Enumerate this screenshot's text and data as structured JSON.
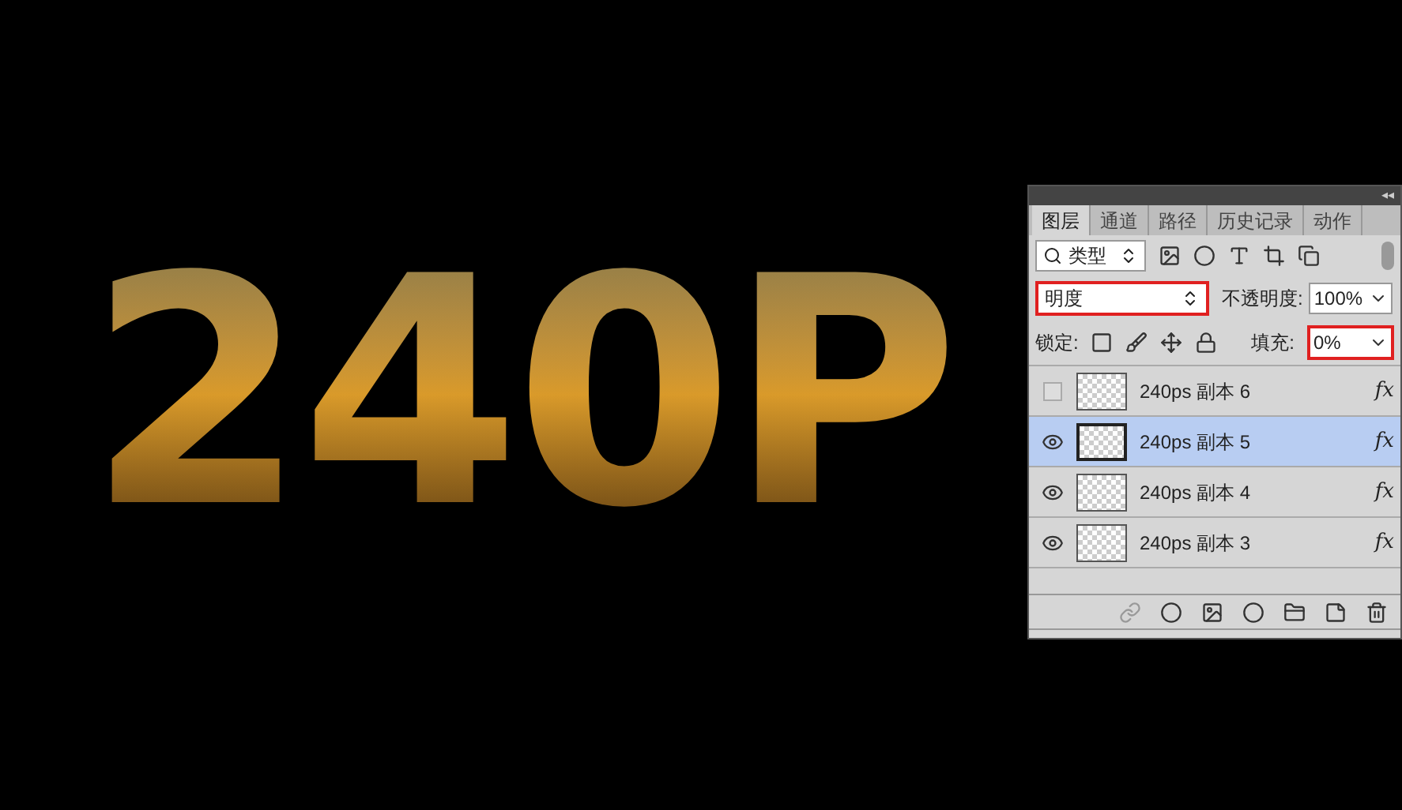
{
  "canvas": {
    "artwork_text": "240P"
  },
  "panel": {
    "collapse": "◂◂",
    "tabs": [
      {
        "label": "图层",
        "selected": true
      },
      {
        "label": "通道",
        "selected": false
      },
      {
        "label": "路径",
        "selected": false
      },
      {
        "label": "历史记录",
        "selected": false
      },
      {
        "label": "动作",
        "selected": false
      }
    ],
    "filter": {
      "value": "类型"
    },
    "blend_mode": {
      "value": "明度",
      "highlighted": true
    },
    "opacity": {
      "label": "不透明度:",
      "value": "100%",
      "highlighted": false
    },
    "lock": {
      "label": "锁定:"
    },
    "fill": {
      "label": "填充:",
      "value": "0%",
      "highlighted": true
    },
    "layers": [
      {
        "name": "240ps 副本 6",
        "effects": "fx",
        "visible": false,
        "selected": false
      },
      {
        "name": "240ps 副本 5",
        "effects": "fx",
        "visible": true,
        "selected": true
      },
      {
        "name": "240ps 副本 4",
        "effects": "fx",
        "visible": true,
        "selected": false
      },
      {
        "name": "240ps 副本 3",
        "effects": "fx",
        "visible": true,
        "selected": false
      }
    ]
  }
}
